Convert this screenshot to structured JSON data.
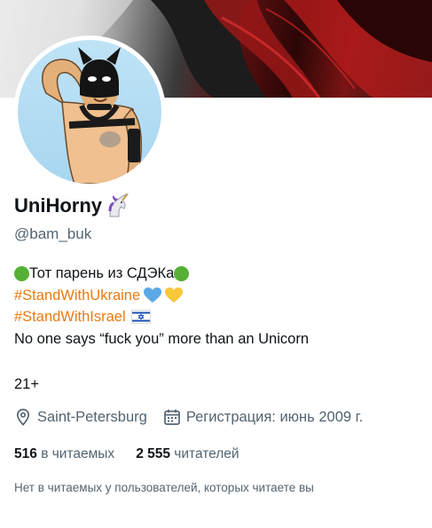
{
  "profile": {
    "display_name": "UniHorny",
    "handle": "@bam_buk",
    "bio": {
      "line1_text": "Тот парень из СДЭКа",
      "hashtag1": "#StandWithUkraine",
      "hashtag2": "#StandWithIsrael",
      "line4_text": "No one says “fuck you” more than an Unicorn"
    },
    "age": "21+",
    "location": "Saint-Petersburg",
    "joined": "Регистрация: июнь 2009 г.",
    "following_count": "516",
    "following_label": "в читаемых",
    "followers_count": "2 555",
    "followers_label": "читателей",
    "mutuals_note": "Нет в читаемых у пользователей, которых читаете вы"
  },
  "icons": {
    "name_emoji": "unicorn-icon",
    "bio_dots": "green-circle-icon",
    "hearts": [
      "blue-heart-icon",
      "yellow-heart-icon"
    ],
    "flag": "israel-flag-icon",
    "location": "location-pin-icon",
    "calendar": "calendar-icon"
  },
  "colors": {
    "hashtag": "#e87a12",
    "secondary_text": "#536471",
    "green_dot": "#55b035",
    "blue_heart": "#5ba8e6",
    "yellow_heart": "#f6c83a"
  }
}
